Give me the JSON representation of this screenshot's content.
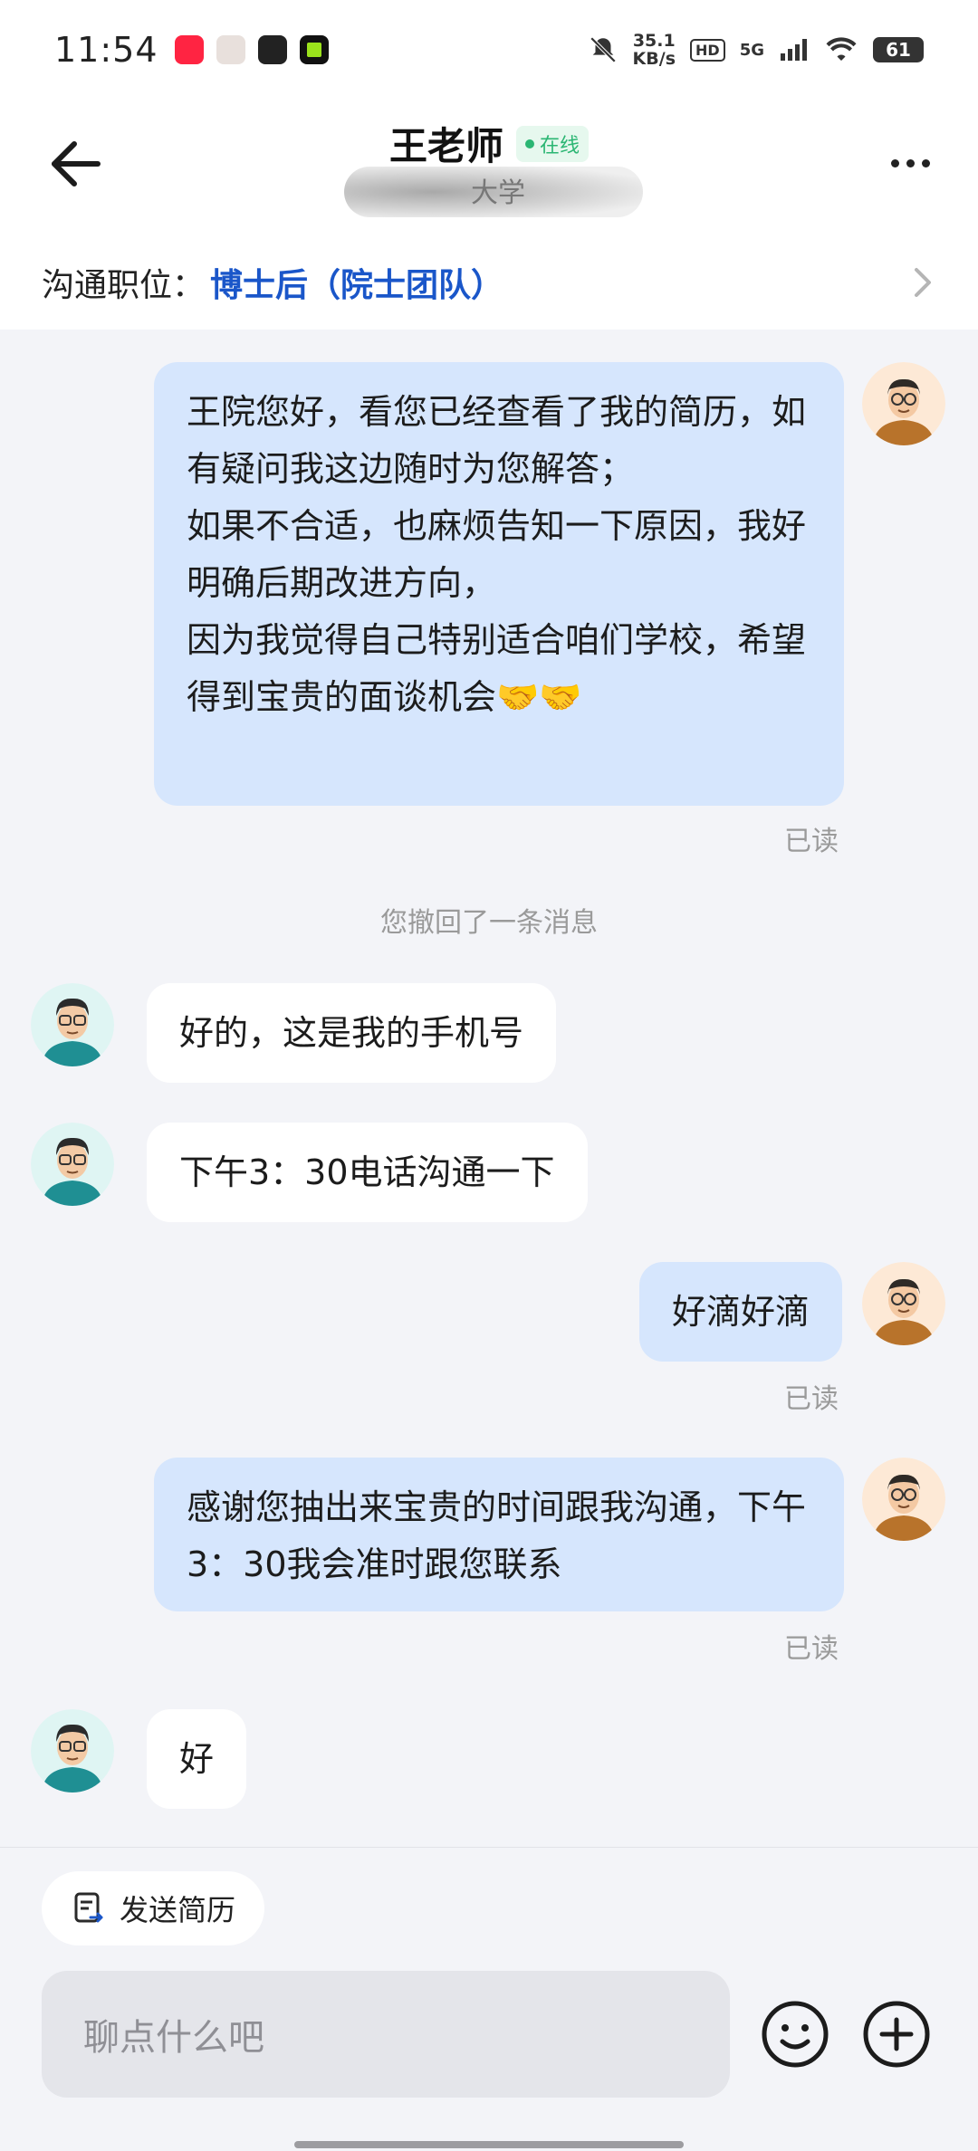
{
  "status_bar": {
    "time": "11:54",
    "net_speed_value": "35.1",
    "net_speed_unit": "KB/s",
    "hd": "HD",
    "network": "5G",
    "battery": "61"
  },
  "header": {
    "contact_name": "王老师",
    "online_label": "在线",
    "subtitle": "大学"
  },
  "position": {
    "label": "沟通职位：",
    "value": "博士后（院士团队）"
  },
  "messages": [
    {
      "side": "out",
      "text": "王院您好，看您已经查看了我的简历，如有疑问我这边随时为您解答；\n如果不合适，也麻烦告知一下原因，我好明确后期改进方向，\n因为我觉得自己特别适合咱们学校，希望得到宝贵的面谈机会🤝🤝",
      "read": "已读"
    },
    {
      "system": "您撤回了一条消息"
    },
    {
      "side": "in",
      "text": "好的，这是我的手机号"
    },
    {
      "side": "in",
      "text": "下午3：30电话沟通一下"
    },
    {
      "side": "out",
      "text": "好滴好滴",
      "read": "已读"
    },
    {
      "side": "out",
      "text": "感谢您抽出来宝贵的时间跟我沟通，下午3：30我会准时跟您联系",
      "read": "已读"
    },
    {
      "side": "in",
      "text": "好"
    }
  ],
  "bottom": {
    "resume_label": "发送简历",
    "input_placeholder": "聊点什么吧"
  },
  "colors": {
    "accent_blue": "#1a56c9",
    "online_green": "#2bb673",
    "bubble_out": "#d6e6fd",
    "bubble_in": "#ffffff"
  },
  "icons": [
    "back-arrow-icon",
    "more-icon",
    "chevron-right-icon",
    "resume-icon",
    "emoji-icon",
    "plus-icon"
  ]
}
